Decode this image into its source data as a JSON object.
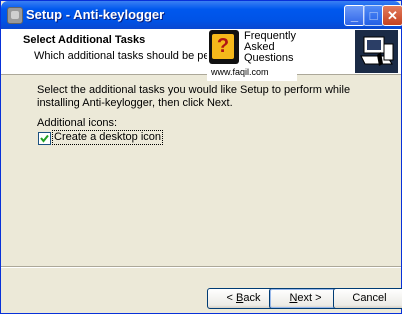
{
  "window": {
    "title": "Setup - Anti-keylogger",
    "minimize": "_",
    "maximize": "□",
    "close": "✕"
  },
  "header": {
    "title": "Select Additional Tasks",
    "subtitle": "Which additional tasks should be performed?"
  },
  "watermark": {
    "line1": "Frequently",
    "line2": "Asked",
    "line3": "Questions",
    "url": "www.faqil.com",
    "mark": "?"
  },
  "content": {
    "instruction": "Select the additional tasks you would like Setup to perform while installing Anti-keylogger, then click Next.",
    "group_label": "Additional icons:",
    "checkbox": {
      "label": "Create a desktop icon",
      "checked": true
    }
  },
  "buttons": {
    "back_prefix": "< ",
    "back_key": "B",
    "back_rest": "ack",
    "next_key": "N",
    "next_rest": "ext >",
    "cancel": "Cancel"
  }
}
